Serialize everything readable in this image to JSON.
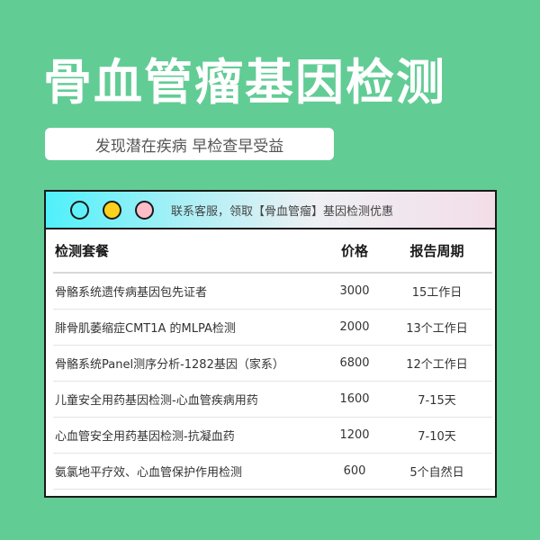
{
  "header": {
    "title": "骨血管瘤基因检测",
    "subtitle": "发现潜在疾病 早检查早受益"
  },
  "window_bar": {
    "dots": [
      {
        "name": "cyan",
        "color": "#5ff1f8"
      },
      {
        "name": "yellow",
        "color": "#ffd11c"
      },
      {
        "name": "pink",
        "color": "#ffbdc8"
      }
    ],
    "message": "联系客服，领取【骨血管瘤】基因检测优惠"
  },
  "table": {
    "headers": {
      "package": "检测套餐",
      "price": "价格",
      "period": "报告周期"
    },
    "rows": [
      {
        "package": "骨骼系统遗传病基因包先证者",
        "price": "3000",
        "period": "15工作日"
      },
      {
        "package": "腓骨肌萎缩症CMT1A 的MLPA检测",
        "price": "2000",
        "period": "13个工作日"
      },
      {
        "package": "骨骼系统Panel测序分析-1282基因（家系）",
        "price": "6800",
        "period": "12个工作日"
      },
      {
        "package": "儿童安全用药基因检测-心血管疾病用药",
        "price": "1600",
        "period": "7-15天"
      },
      {
        "package": "心血管安全用药基因检测-抗凝血药",
        "price": "1200",
        "period": "7-10天"
      },
      {
        "package": "氨氯地平疗效、心血管保护作用检测",
        "price": "600",
        "period": "5个自然日"
      }
    ]
  },
  "colors": {
    "background": "#62cc95",
    "window_border": "#1a1a1a"
  }
}
